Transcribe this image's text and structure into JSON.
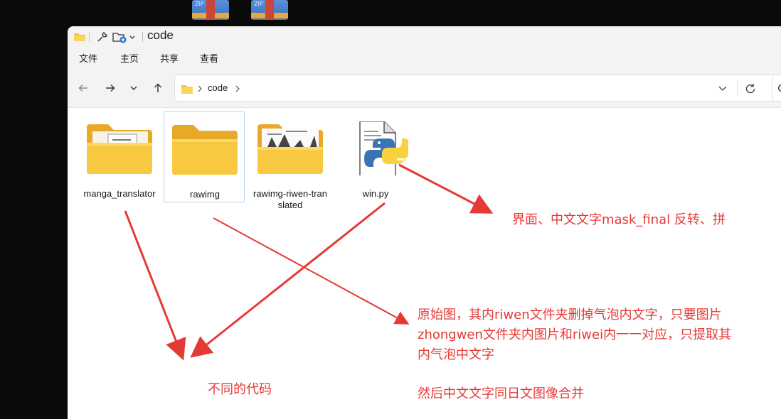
{
  "desktop": {
    "icons": [
      {
        "kind": "zip-archive",
        "label": "ZIP"
      },
      {
        "kind": "zip-archive",
        "label": "ZIP"
      }
    ]
  },
  "window": {
    "title": "code",
    "menu": [
      "文件",
      "主页",
      "共享",
      "查看"
    ],
    "address": {
      "segments": [
        "code"
      ]
    }
  },
  "files": [
    {
      "name": "manga_translator",
      "type": "folder-with-document",
      "selected": false
    },
    {
      "name": "rawimg",
      "type": "folder",
      "selected": true
    },
    {
      "name": "rawimg-riwen-translated",
      "type": "folder-with-images",
      "selected": false
    },
    {
      "name": "win.py",
      "type": "python-file",
      "selected": false
    }
  ],
  "annotations": {
    "note_interface": "界面、中文文字mask_final 反转、拼",
    "note_original_lines": [
      "原始图，其内riwen文件夹删掉气泡内文字，只要图片",
      "zhongwen文件夹内图片和riwei内一一对应，只提取其",
      "内气泡中文字"
    ],
    "note_merge": "然后中文文字同日文图像合并",
    "note_different_code": "不同的代码"
  },
  "colors": {
    "annotation": "#e53935",
    "folder": "#f5c33b",
    "selection_border": "#b7d4f0"
  }
}
